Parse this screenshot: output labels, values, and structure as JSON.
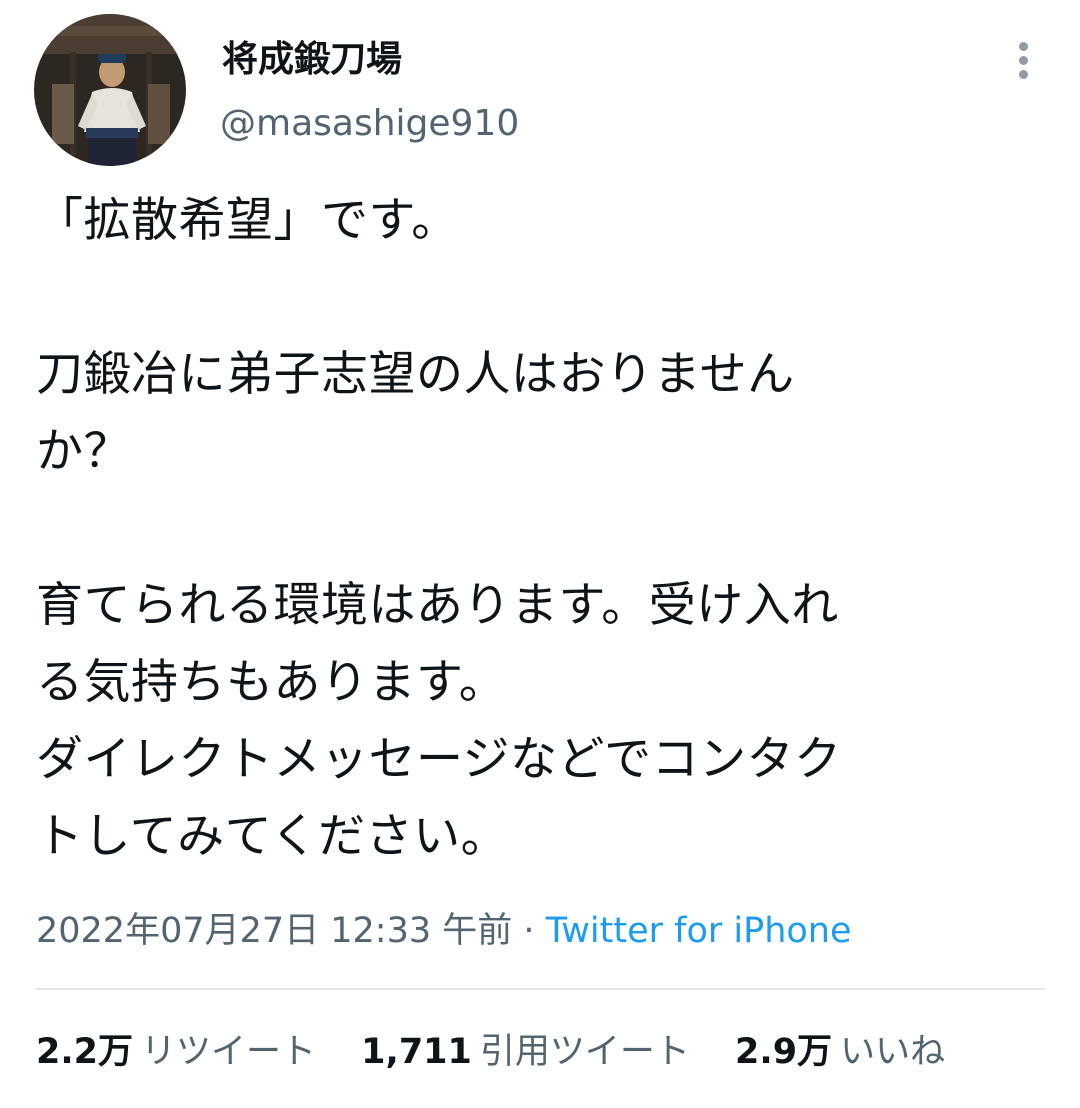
{
  "account": {
    "display_name": "将成鍛刀場",
    "handle": "@masashige910"
  },
  "menu": {
    "more_icon": "more-vertical-icon"
  },
  "tweet": {
    "text": "「拡散希望」です。\n\n刀鍛冶に弟子志望の人はおりません\nか？\n\n育てられる環境はあります。受け入れ\nる気持ちもあります。\nダイレクトメッセージなどでコンタク\nトしてみてください。"
  },
  "meta": {
    "timestamp": "2022年07月27日 12:33 午前",
    "separator": "·",
    "source": "Twitter for iPhone"
  },
  "stats": {
    "retweets_count": "2.2万",
    "retweets_label": "リツイート",
    "quotes_count": "1,711",
    "quotes_label": "引用ツイート",
    "likes_count": "2.9万",
    "likes_label": "いいね"
  },
  "colors": {
    "text": "#0f1419",
    "secondary": "#536471",
    "link": "#1d9bf0",
    "divider": "#e4e8eb"
  }
}
